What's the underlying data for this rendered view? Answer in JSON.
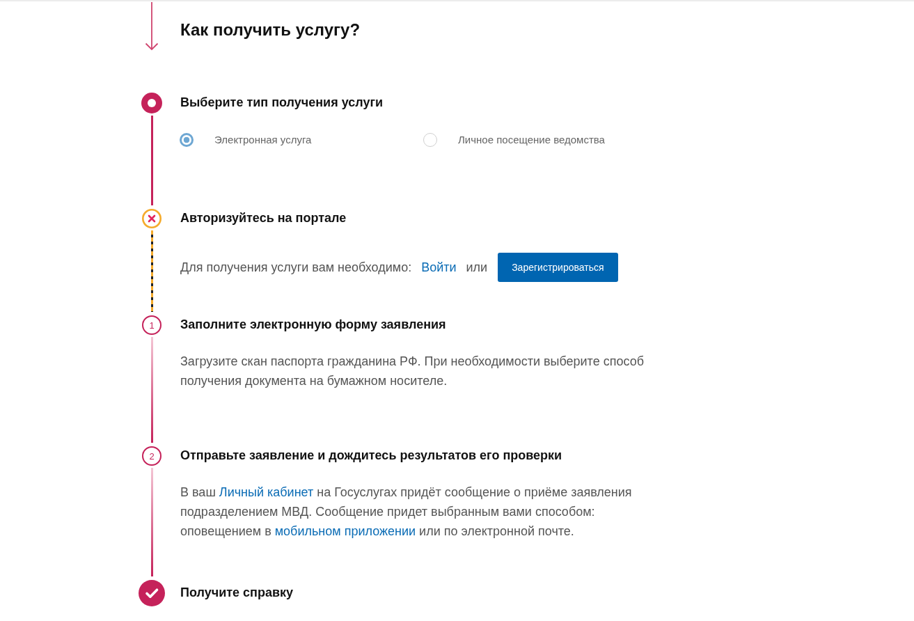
{
  "heading": "Как получить услугу?",
  "steps": [
    {
      "kind": "current",
      "title": "Выберите тип получения услуги",
      "body": {
        "kind": "radio_group",
        "options": [
          {
            "label": "Электронная услуга",
            "selected": true
          },
          {
            "label": "Личное посещение ведомства",
            "selected": false
          }
        ]
      }
    },
    {
      "kind": "error",
      "title": "Авторизуйтесь на портале",
      "body": {
        "kind": "auth",
        "prompt": "Для получения услуги вам необходимо:",
        "login_link": "Войти",
        "separator": "или",
        "register_button": "Зарегистрироваться"
      }
    },
    {
      "kind": "numbered",
      "number": "1",
      "title": "Заполните электронную форму заявления",
      "body": {
        "kind": "paragraph",
        "segments": [
          {
            "kind": "text",
            "text": "Загрузите скан паспорта гражданина РФ. При необходимости выберите способ получения документа на бумажном носителе."
          }
        ]
      }
    },
    {
      "kind": "numbered",
      "number": "2",
      "title": "Отправьте заявление и дождитесь результатов его проверки",
      "body": {
        "kind": "paragraph",
        "segments": [
          {
            "kind": "text",
            "text": "В ваш "
          },
          {
            "kind": "link",
            "text": "Личный кабинет"
          },
          {
            "kind": "text",
            "text": " на Госуслугах придёт сообщение о приёме заявления подразделением МВД. Сообщение придет выбранным вами способом: оповещением в "
          },
          {
            "kind": "link",
            "text": "мобильном приложении"
          },
          {
            "kind": "text",
            "text": " или по электронной почте."
          }
        ]
      }
    },
    {
      "kind": "final",
      "title": "Получите справку"
    }
  ]
}
